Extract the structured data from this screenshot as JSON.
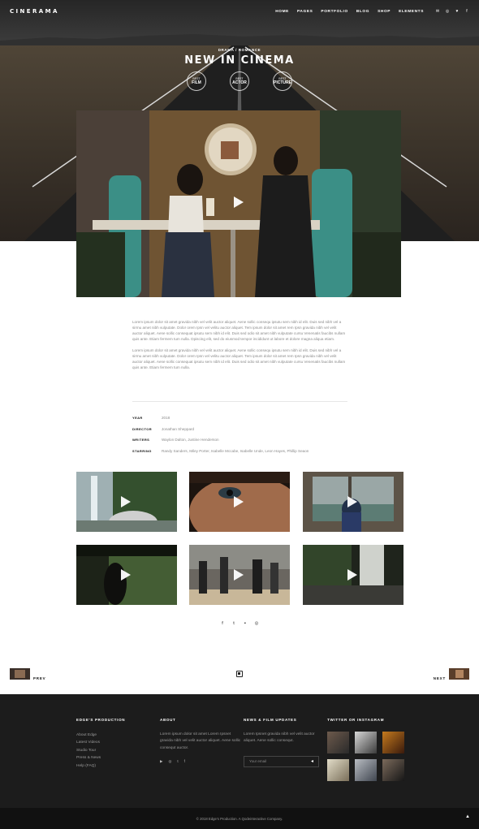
{
  "brand": {
    "logo": "CINERAMA"
  },
  "nav": {
    "items": [
      "HOME",
      "PAGES",
      "PORTFOLIO",
      "BLOG",
      "SHOP",
      "ELEMENTS"
    ],
    "icons": [
      "mail-icon",
      "instagram-icon",
      "twitter-icon",
      "facebook-icon"
    ]
  },
  "hero": {
    "category": "DRAMA / ROMANCE",
    "title": "NEW IN CINEMA",
    "awards": [
      {
        "top": "BEST",
        "main": "FILM"
      },
      {
        "top": "BEST",
        "main": "ACTOR"
      },
      {
        "top": "BEST",
        "main": "PICTURE"
      }
    ]
  },
  "description": {
    "p1": "Lorem ipsum dolor sit amet gravida nibh vel velit auctor aliquet. Aene sollic consequ ipsutu sem nibh id elit. Duis sed nibh vel a sirmu amet nibh vulputate. Dolor orem Ipsn vel velitu auctor aliquet. Tem ipsum dolor sit amet rem Ipsn gravida nibh vel velit auctor aliquet. Aene sollic consequat ipsutu sem nibh id elit. Duis sed odio sit amet nibh vulputate cursu Venenatis faucibs nullam quis ante. Etiam fermem tum nulla. Dpiscing elit, sed do eiusmod tempor incididunt ut labore et dolore magna aliqua etiam.",
    "p2": "Lorem ipsum dolor sit amet gravida nibh vel velit auctor aliquet. Aene sollic consequ ipsutu sem nibh id elit. Duis sed nibh vel a sirmu amet nibh vulputate. Dolor orem Ipsn vel velitu auctor aliquet. Tem ipsum dolor sit amet rem Ipsn gravida nibh vel velit auctor aliquet. Aene sollic consequat ipsutu sem nibh id elit. Duis sed odio sit amet nibh vulputate cursu Venenatis faucibs nullam quis ante. Etiam fermem tum nulla."
  },
  "meta": [
    {
      "label": "YEAR",
      "value": "2018"
    },
    {
      "label": "DIRECTOR",
      "value": "Jonathan Sheppard"
    },
    {
      "label": "WRITERS",
      "value": "Waylon Dalton, Justine Henderson"
    },
    {
      "label": "STARRING",
      "value": "Randy Sanders, Miley Porter, Isabelle Mccabe, Isabelle Unde, Leon Hayes, Phillip Seaon"
    }
  ],
  "social": [
    "facebook-icon",
    "twitter-icon",
    "flickr-icon",
    "instagram-icon"
  ],
  "pagination": {
    "prev": "PREV",
    "next": "NEXT"
  },
  "footer": {
    "col1": {
      "heading": "EDGE'S PRODUCTION",
      "links": [
        "About Edge",
        "Latest Videos",
        "Studio Tour",
        "Press & News",
        "Help (FAQ)"
      ]
    },
    "col2": {
      "heading": "ABOUT",
      "text": "Lorem ipsum dolor sit amet Lorem Ipsnet gravida nibh vel velit auctor aliquet. Aene sollic consequt auctor."
    },
    "col3": {
      "heading": "NEWS & FILM UPDATES",
      "text": "Lorem Ipsnet gravida nibh vel velit auctor aliquet. Aene sollic consequt.",
      "email_placeholder": "Your email"
    },
    "col4": {
      "heading": "TWITTER OR INSTAGRAM"
    },
    "copyright": "© 2018 Edge's Production. A Qodeinteractive Company."
  },
  "colors": {
    "footer_bg": "#1c1c1c",
    "copyright_bg": "#111111",
    "accent": "#ffffff"
  }
}
